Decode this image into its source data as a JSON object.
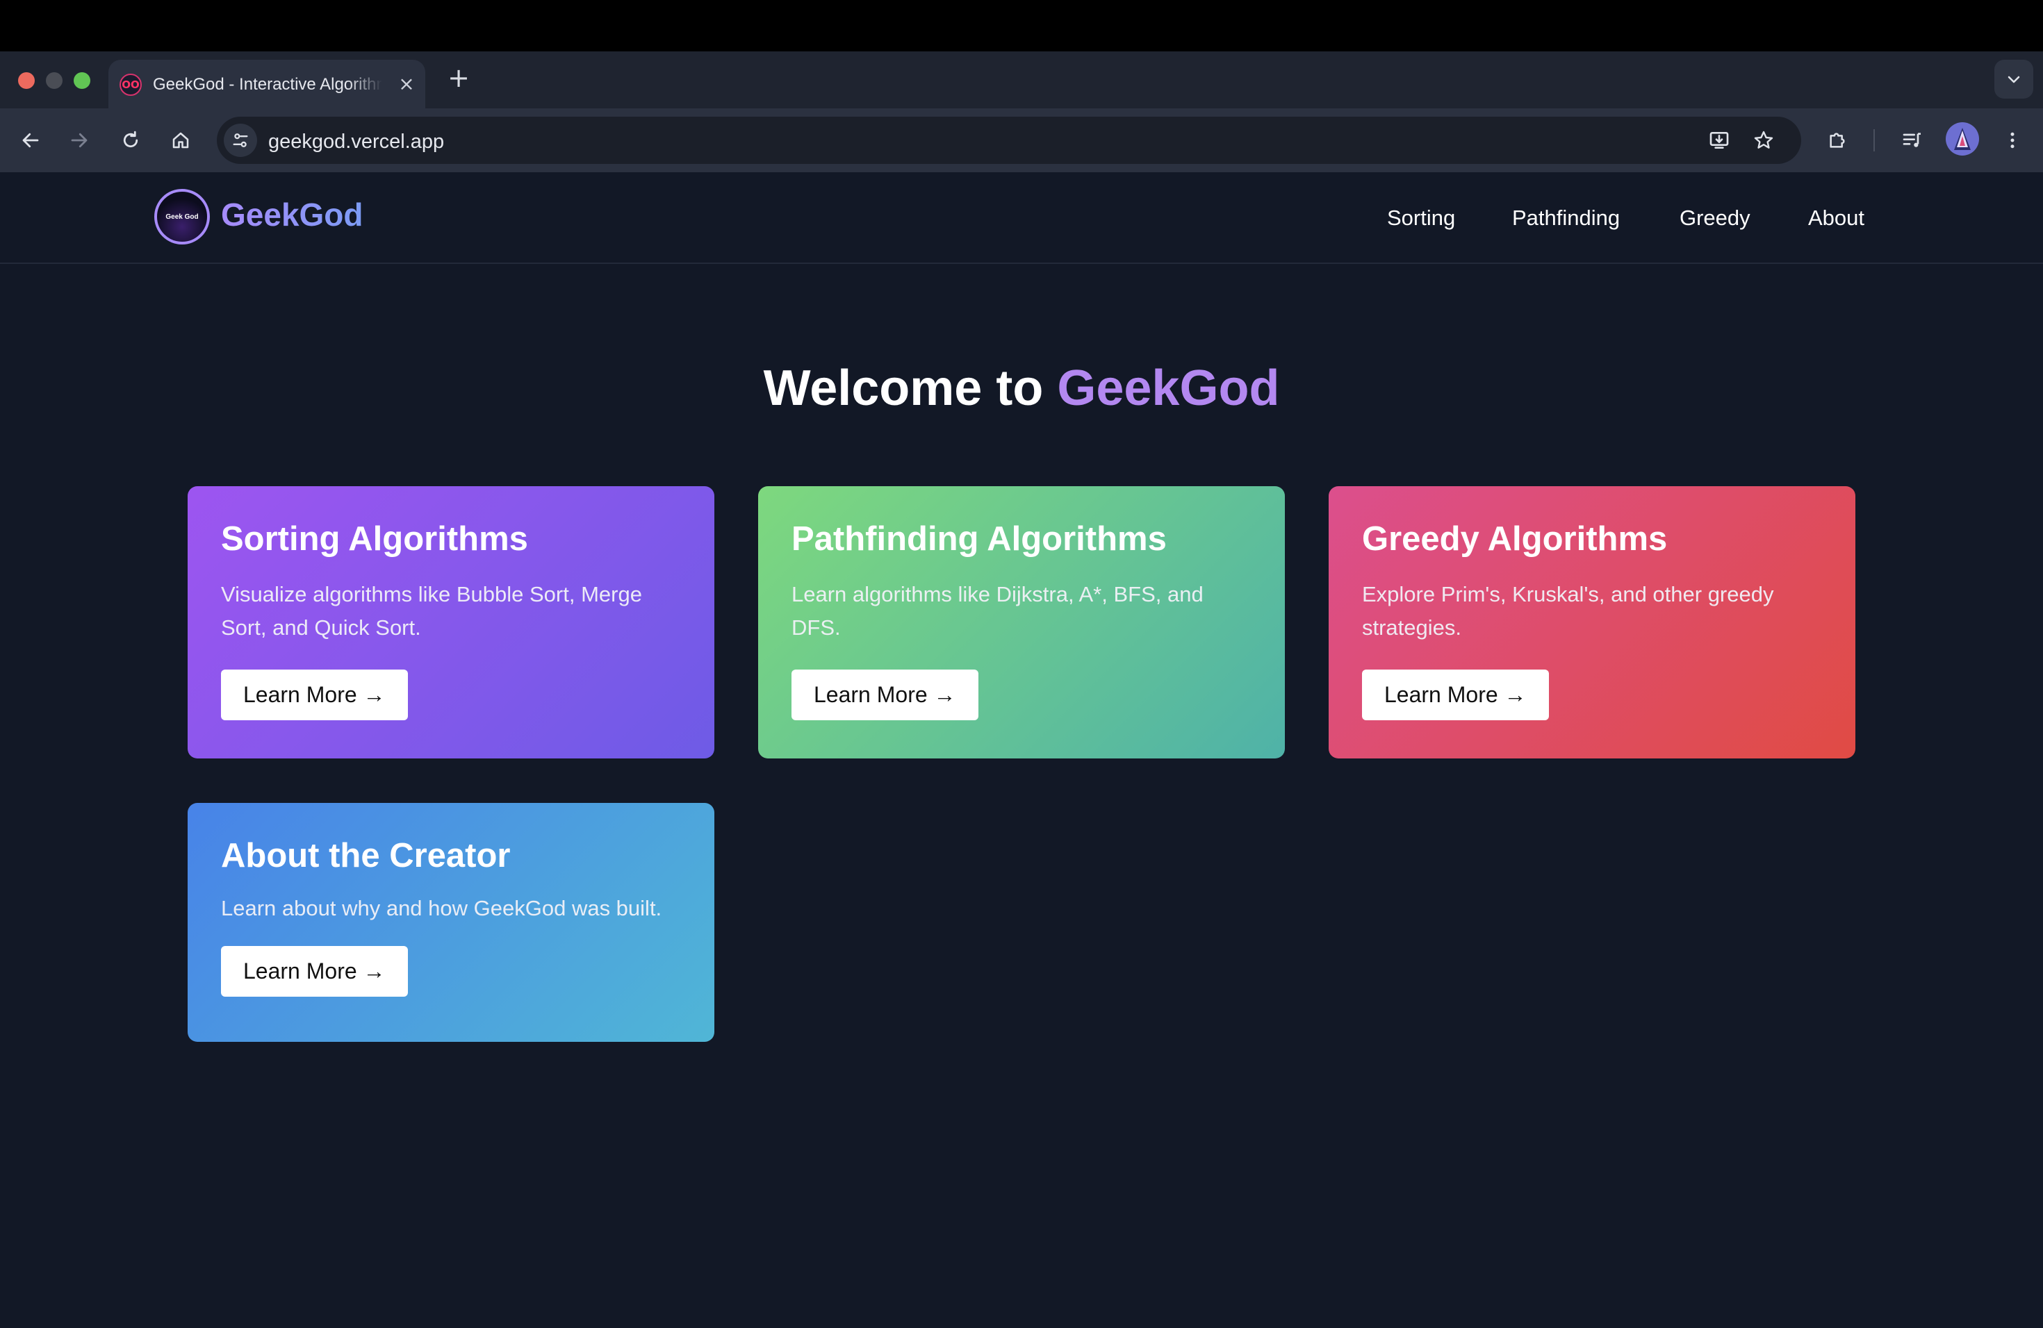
{
  "browser": {
    "tab_title": "GeekGod - Interactive Algorithms",
    "favicon_text": "OO",
    "new_tab_symbol": "+",
    "close_symbol": "×",
    "url": "geekgod.vercel.app"
  },
  "site": {
    "logo_text": "Geek God",
    "brand": "GeekGod",
    "nav": [
      "Sorting",
      "Pathfinding",
      "Greedy",
      "About"
    ],
    "hero_prefix": "Welcome to ",
    "hero_accent": "GeekGod",
    "cards": [
      {
        "title": "Sorting Algorithms",
        "description": "Visualize algorithms like Bubble Sort, Merge Sort, and Quick Sort.",
        "button": "Learn More →"
      },
      {
        "title": "Pathfinding Algorithms",
        "description": "Learn algorithms like Dijkstra, A*, BFS, and DFS.",
        "button": "Learn More →"
      },
      {
        "title": "Greedy Algorithms",
        "description": "Explore Prim's, Kruskal's, and other greedy strategies.",
        "button": "Learn More →"
      },
      {
        "title": "About the Creator",
        "description": "Learn about why and how GeekGod was built.",
        "button": "Learn More →"
      }
    ]
  },
  "colors": {
    "page_background": "#121826",
    "accent": "#b388f0"
  }
}
